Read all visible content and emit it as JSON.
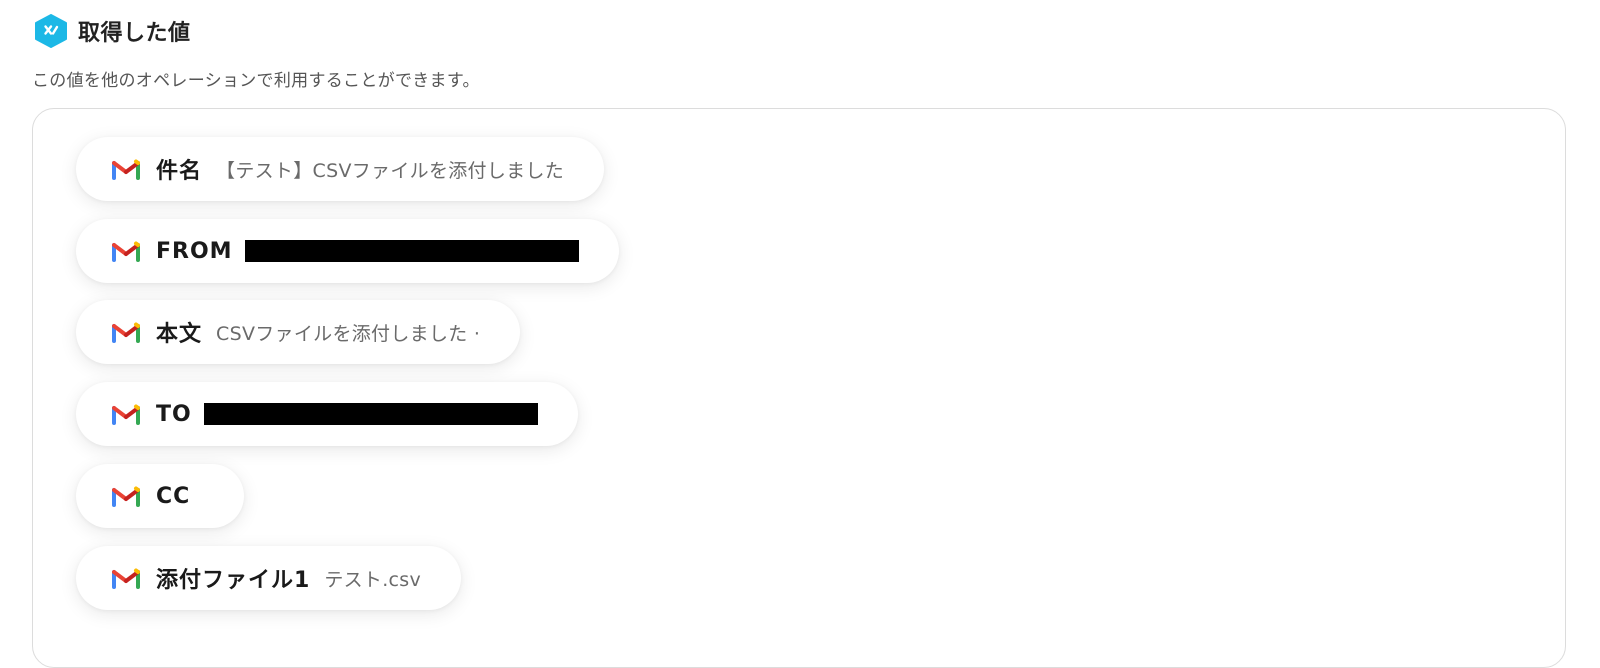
{
  "section": {
    "title": "取得した値",
    "description": "この値を他のオペレーションで利用することができます。",
    "icon": "yoom-hex-icon",
    "accent_color": "#1cb8e6"
  },
  "chips": [
    {
      "label": "件名",
      "value": "【テスト】CSVファイルを添付しました",
      "redacted": false,
      "icon": "gmail-icon"
    },
    {
      "label": "FROM",
      "value": "",
      "redacted": true,
      "icon": "gmail-icon"
    },
    {
      "label": "本文",
      "value": "CSVファイルを添付しました ·",
      "redacted": false,
      "icon": "gmail-icon"
    },
    {
      "label": "TO",
      "value": "",
      "redacted": true,
      "icon": "gmail-icon"
    },
    {
      "label": "CC",
      "value": "",
      "redacted": false,
      "icon": "gmail-icon"
    },
    {
      "label": "添付ファイル1",
      "value": "テスト.csv",
      "redacted": false,
      "icon": "gmail-icon"
    }
  ]
}
